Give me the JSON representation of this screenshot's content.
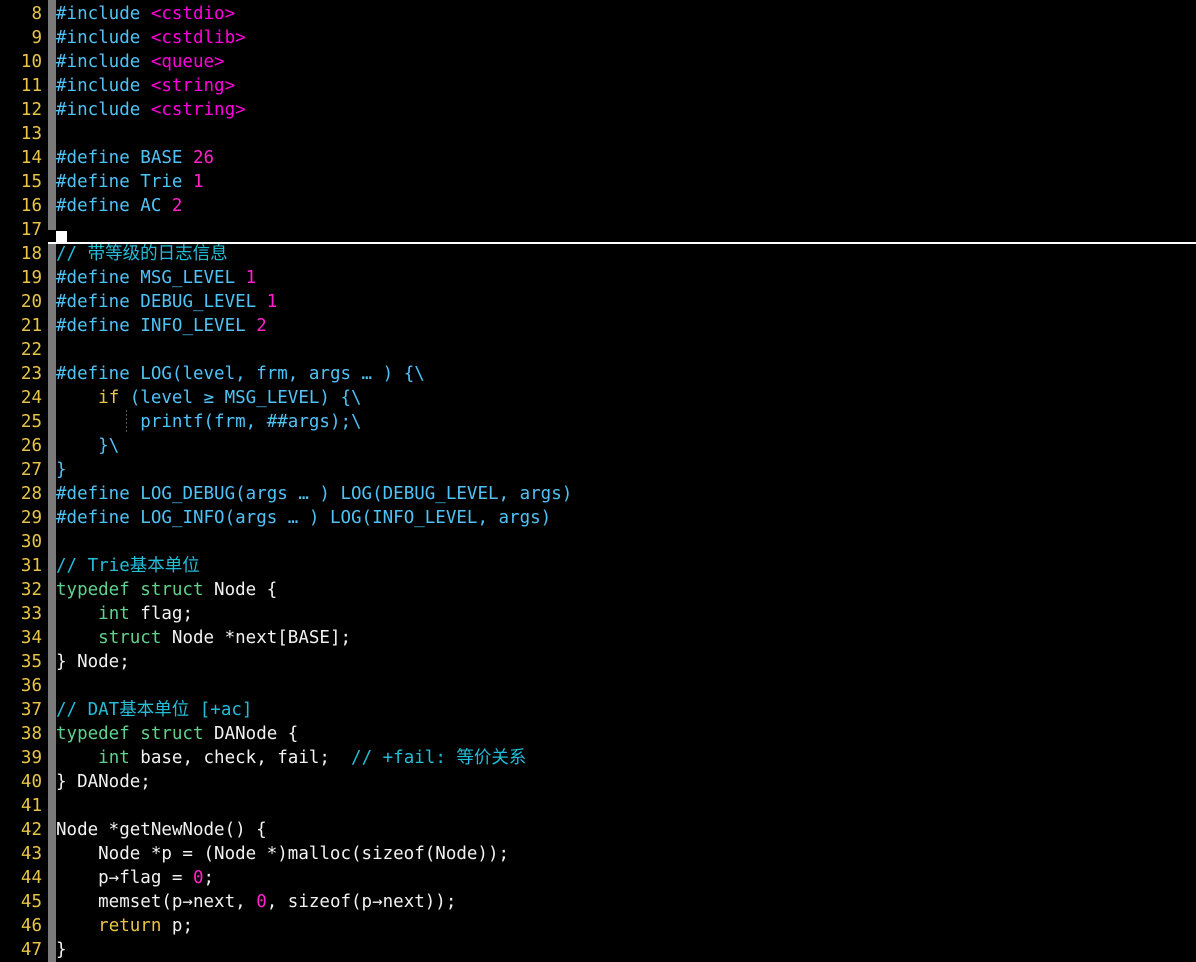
{
  "editor": {
    "name": "code-editor",
    "language": "C++",
    "background_color": "#000000",
    "line_number_color": "#e9c547",
    "cursor": {
      "line": 18,
      "column": 1,
      "color": "#ffffff"
    },
    "colors": {
      "preprocessor": "#4fc3f7",
      "header": "#ff00dd",
      "number": "#ff22cc",
      "comment": "#23bdd8",
      "keyword": "#e9c547",
      "type": "#5fd38d",
      "plain": "#f2f2f2",
      "change_bar": "#7a7a7a"
    },
    "first_visible_line": 8,
    "last_visible_line": 47
  },
  "lines": [
    {
      "n": "8",
      "tokens": [
        {
          "c": "t-pre",
          "t": "#include "
        },
        {
          "c": "t-header",
          "t": "<cstdio>"
        }
      ]
    },
    {
      "n": "9",
      "tokens": [
        {
          "c": "t-pre",
          "t": "#include "
        },
        {
          "c": "t-header",
          "t": "<cstdlib>"
        }
      ]
    },
    {
      "n": "10",
      "tokens": [
        {
          "c": "t-pre",
          "t": "#include "
        },
        {
          "c": "t-header",
          "t": "<queue>"
        }
      ]
    },
    {
      "n": "11",
      "tokens": [
        {
          "c": "t-pre",
          "t": "#include "
        },
        {
          "c": "t-header",
          "t": "<string>"
        }
      ]
    },
    {
      "n": "12",
      "tokens": [
        {
          "c": "t-pre",
          "t": "#include "
        },
        {
          "c": "t-header",
          "t": "<cstring>"
        }
      ]
    },
    {
      "n": "13",
      "tokens": []
    },
    {
      "n": "14",
      "tokens": [
        {
          "c": "t-pre",
          "t": "#define "
        },
        {
          "c": "t-ident",
          "t": "BASE "
        },
        {
          "c": "t-num",
          "t": "26"
        }
      ]
    },
    {
      "n": "15",
      "tokens": [
        {
          "c": "t-pre",
          "t": "#define "
        },
        {
          "c": "t-ident",
          "t": "Trie "
        },
        {
          "c": "t-num",
          "t": "1"
        }
      ]
    },
    {
      "n": "16",
      "tokens": [
        {
          "c": "t-pre",
          "t": "#define "
        },
        {
          "c": "t-ident",
          "t": "AC "
        },
        {
          "c": "t-num",
          "t": "2"
        }
      ]
    },
    {
      "n": "17",
      "tokens": []
    },
    {
      "n": "18",
      "cursor": true,
      "tokens": [
        {
          "c": "t-comment",
          "t": "// 带等级的日志信息"
        }
      ]
    },
    {
      "n": "19",
      "tokens": [
        {
          "c": "t-pre",
          "t": "#define "
        },
        {
          "c": "t-ident",
          "t": "MSG_LEVEL "
        },
        {
          "c": "t-num",
          "t": "1"
        }
      ]
    },
    {
      "n": "20",
      "tokens": [
        {
          "c": "t-pre",
          "t": "#define "
        },
        {
          "c": "t-ident",
          "t": "DEBUG_LEVEL "
        },
        {
          "c": "t-num",
          "t": "1"
        }
      ]
    },
    {
      "n": "21",
      "tokens": [
        {
          "c": "t-pre",
          "t": "#define "
        },
        {
          "c": "t-ident",
          "t": "INFO_LEVEL "
        },
        {
          "c": "t-num",
          "t": "2"
        }
      ]
    },
    {
      "n": "22",
      "tokens": []
    },
    {
      "n": "23",
      "tokens": [
        {
          "c": "t-pre",
          "t": "#define "
        },
        {
          "c": "t-ident",
          "t": "LOG(level, frm, args … ) {\\"
        }
      ]
    },
    {
      "n": "24",
      "tokens": [
        {
          "c": "t-plain",
          "t": "    "
        },
        {
          "c": "t-kw",
          "t": "if"
        },
        {
          "c": "t-ident",
          "t": " (level ≥ MSG_LEVEL) {\\"
        }
      ]
    },
    {
      "n": "25",
      "indent_guide": true,
      "tokens": [
        {
          "c": "t-plain",
          "t": "        "
        },
        {
          "c": "t-ident",
          "t": "printf(frm, ##args);\\"
        }
      ]
    },
    {
      "n": "26",
      "tokens": [
        {
          "c": "t-plain",
          "t": "    "
        },
        {
          "c": "t-ident",
          "t": "}\\"
        }
      ]
    },
    {
      "n": "27",
      "tokens": [
        {
          "c": "t-brace",
          "t": "}"
        }
      ]
    },
    {
      "n": "28",
      "tokens": [
        {
          "c": "t-pre",
          "t": "#define "
        },
        {
          "c": "t-ident",
          "t": "LOG_DEBUG(args … ) LOG(DEBUG_LEVEL, args)"
        }
      ]
    },
    {
      "n": "29",
      "tokens": [
        {
          "c": "t-pre",
          "t": "#define "
        },
        {
          "c": "t-ident",
          "t": "LOG_INFO(args … ) LOG(INFO_LEVEL, args)"
        }
      ]
    },
    {
      "n": "30",
      "tokens": []
    },
    {
      "n": "31",
      "tokens": [
        {
          "c": "t-comment",
          "t": "// Trie基本单位"
        }
      ]
    },
    {
      "n": "32",
      "tokens": [
        {
          "c": "t-type",
          "t": "typedef struct"
        },
        {
          "c": "t-plain",
          "t": " Node {"
        }
      ]
    },
    {
      "n": "33",
      "tokens": [
        {
          "c": "t-plain",
          "t": "    "
        },
        {
          "c": "t-type",
          "t": "int"
        },
        {
          "c": "t-plain",
          "t": " flag;"
        }
      ]
    },
    {
      "n": "34",
      "tokens": [
        {
          "c": "t-plain",
          "t": "    "
        },
        {
          "c": "t-type",
          "t": "struct"
        },
        {
          "c": "t-plain",
          "t": " Node *next[BASE];"
        }
      ]
    },
    {
      "n": "35",
      "tokens": [
        {
          "c": "t-plain",
          "t": "} Node;"
        }
      ]
    },
    {
      "n": "36",
      "tokens": []
    },
    {
      "n": "37",
      "tokens": [
        {
          "c": "t-comment",
          "t": "// DAT基本单位 [+ac]"
        }
      ]
    },
    {
      "n": "38",
      "tokens": [
        {
          "c": "t-type",
          "t": "typedef struct"
        },
        {
          "c": "t-plain",
          "t": " DANode {"
        }
      ]
    },
    {
      "n": "39",
      "tokens": [
        {
          "c": "t-plain",
          "t": "    "
        },
        {
          "c": "t-type",
          "t": "int"
        },
        {
          "c": "t-plain",
          "t": " base, check, fail;  "
        },
        {
          "c": "t-comment",
          "t": "// +fail: 等价关系"
        }
      ]
    },
    {
      "n": "40",
      "tokens": [
        {
          "c": "t-plain",
          "t": "} DANode;"
        }
      ]
    },
    {
      "n": "41",
      "tokens": []
    },
    {
      "n": "42",
      "tokens": [
        {
          "c": "t-plain",
          "t": "Node *getNewNode() {"
        }
      ]
    },
    {
      "n": "43",
      "tokens": [
        {
          "c": "t-plain",
          "t": "    Node *p = (Node *)malloc(sizeof(Node));"
        }
      ]
    },
    {
      "n": "44",
      "tokens": [
        {
          "c": "t-plain",
          "t": "    p→flag = "
        },
        {
          "c": "t-num",
          "t": "0"
        },
        {
          "c": "t-plain",
          "t": ";"
        }
      ]
    },
    {
      "n": "45",
      "tokens": [
        {
          "c": "t-plain",
          "t": "    memset(p→next, "
        },
        {
          "c": "t-num",
          "t": "0"
        },
        {
          "c": "t-plain",
          "t": ", sizeof(p→next));"
        }
      ]
    },
    {
      "n": "46",
      "tokens": [
        {
          "c": "t-plain",
          "t": "    "
        },
        {
          "c": "t-kw",
          "t": "return"
        },
        {
          "c": "t-plain",
          "t": " p;"
        }
      ]
    },
    {
      "n": "47",
      "tokens": [
        {
          "c": "t-plain",
          "t": "}"
        }
      ]
    }
  ]
}
